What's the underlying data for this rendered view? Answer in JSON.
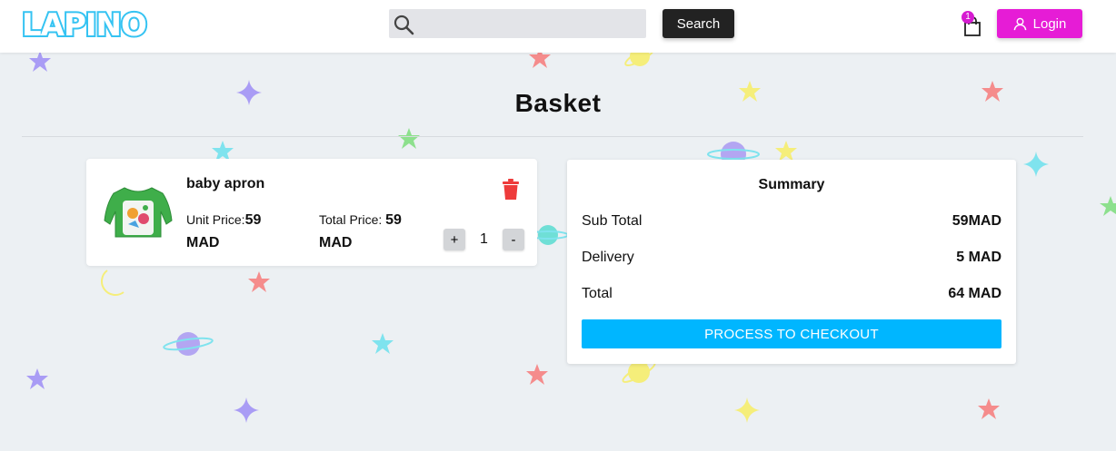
{
  "header": {
    "logo_text": "LAPINO",
    "search": {
      "placeholder": "",
      "value": "",
      "button_label": "Search"
    },
    "cart_count": "1",
    "login_label": "Login"
  },
  "page": {
    "title": "Basket"
  },
  "basket": {
    "items": [
      {
        "name": "baby apron",
        "unit_price_label": "Unit Price:",
        "unit_price": "59",
        "total_price_label": "Total Price:",
        "total_price": "59",
        "currency": "MAD",
        "quantity": "1",
        "plus_label": "+",
        "minus_label": "-"
      }
    ]
  },
  "summary": {
    "title": "Summary",
    "rows": [
      {
        "label": "Sub Total",
        "value": "59MAD"
      },
      {
        "label": "Delivery",
        "value": "5 MAD"
      },
      {
        "label": "Total",
        "value": "64 MAD"
      }
    ],
    "checkout_label": "PROCESS TO CHECKOUT"
  },
  "colors": {
    "logo": "#35c3f2",
    "login": "#e61cd6",
    "checkout": "#00b6ff",
    "delete": "#ee3b3b",
    "background": "#ecf0f3"
  }
}
